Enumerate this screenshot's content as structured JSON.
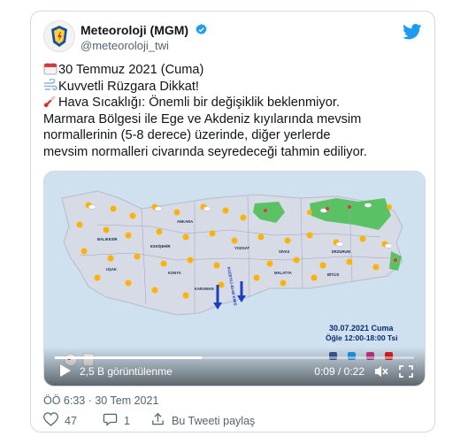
{
  "tweet": {
    "author_name": "Meteoroloji (MGM)",
    "author_handle": "@meteoroloji_twi",
    "lines": [
      "30 Temmuz 2021 (Cuma)",
      "Kuvvetli Rüzgara Dikkat!",
      "Hava Sıcaklığı: Önemli bir değişiklik beklenmiyor.",
      "Marmara Bölgesi ile Ege ve Akdeniz kıyılarında mevsim",
      "normallerinin (5-8 derece) üzerinde, diğer yerlerde",
      "mevsim normalleri civarında seyredeceği tahmin ediliyor."
    ],
    "timestamp": "ÖÖ 6:33 · 30 Tem 2021",
    "likes": "47",
    "replies": "1",
    "share_label": "Bu Tweeti paylaş"
  },
  "icons": {
    "line_icons": [
      "calendar-icon",
      "wind-icon",
      "thermometer-icon"
    ],
    "brand": "twitter-bird-icon"
  },
  "video": {
    "views": "2,5 B görüntülenme",
    "time": "0:09 / 0:22",
    "progress": 0.41,
    "overlay_date": "30.07.2021 Cuma",
    "overlay_time": "Öğle 12:00-18:00 Tsi",
    "map_label": "ANKARA",
    "wind_label": "KUZEYLİ 40-60 KM/S"
  },
  "colors": {
    "twitter_blue": "#1d9bf0",
    "like_red": "#f91880",
    "land": "#d7dbe6",
    "sea": "#cfe1ef",
    "storm_area": "#4cbf55"
  }
}
